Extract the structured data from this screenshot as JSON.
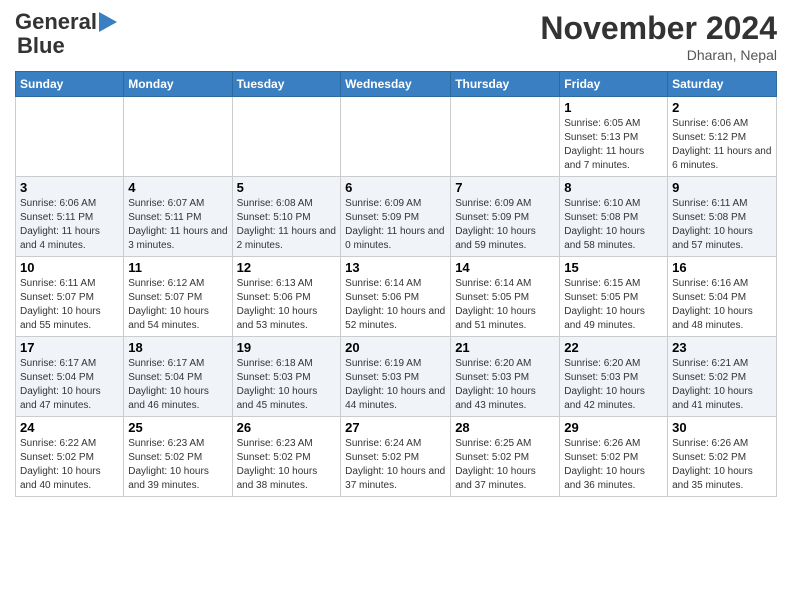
{
  "header": {
    "logo_general": "General",
    "logo_blue": "Blue",
    "month_title": "November 2024",
    "location": "Dharan, Nepal"
  },
  "weekdays": [
    "Sunday",
    "Monday",
    "Tuesday",
    "Wednesday",
    "Thursday",
    "Friday",
    "Saturday"
  ],
  "weeks": [
    [
      {
        "day": "",
        "info": ""
      },
      {
        "day": "",
        "info": ""
      },
      {
        "day": "",
        "info": ""
      },
      {
        "day": "",
        "info": ""
      },
      {
        "day": "",
        "info": ""
      },
      {
        "day": "1",
        "info": "Sunrise: 6:05 AM\nSunset: 5:13 PM\nDaylight: 11 hours and 7 minutes."
      },
      {
        "day": "2",
        "info": "Sunrise: 6:06 AM\nSunset: 5:12 PM\nDaylight: 11 hours and 6 minutes."
      }
    ],
    [
      {
        "day": "3",
        "info": "Sunrise: 6:06 AM\nSunset: 5:11 PM\nDaylight: 11 hours and 4 minutes."
      },
      {
        "day": "4",
        "info": "Sunrise: 6:07 AM\nSunset: 5:11 PM\nDaylight: 11 hours and 3 minutes."
      },
      {
        "day": "5",
        "info": "Sunrise: 6:08 AM\nSunset: 5:10 PM\nDaylight: 11 hours and 2 minutes."
      },
      {
        "day": "6",
        "info": "Sunrise: 6:09 AM\nSunset: 5:09 PM\nDaylight: 11 hours and 0 minutes."
      },
      {
        "day": "7",
        "info": "Sunrise: 6:09 AM\nSunset: 5:09 PM\nDaylight: 10 hours and 59 minutes."
      },
      {
        "day": "8",
        "info": "Sunrise: 6:10 AM\nSunset: 5:08 PM\nDaylight: 10 hours and 58 minutes."
      },
      {
        "day": "9",
        "info": "Sunrise: 6:11 AM\nSunset: 5:08 PM\nDaylight: 10 hours and 57 minutes."
      }
    ],
    [
      {
        "day": "10",
        "info": "Sunrise: 6:11 AM\nSunset: 5:07 PM\nDaylight: 10 hours and 55 minutes."
      },
      {
        "day": "11",
        "info": "Sunrise: 6:12 AM\nSunset: 5:07 PM\nDaylight: 10 hours and 54 minutes."
      },
      {
        "day": "12",
        "info": "Sunrise: 6:13 AM\nSunset: 5:06 PM\nDaylight: 10 hours and 53 minutes."
      },
      {
        "day": "13",
        "info": "Sunrise: 6:14 AM\nSunset: 5:06 PM\nDaylight: 10 hours and 52 minutes."
      },
      {
        "day": "14",
        "info": "Sunrise: 6:14 AM\nSunset: 5:05 PM\nDaylight: 10 hours and 51 minutes."
      },
      {
        "day": "15",
        "info": "Sunrise: 6:15 AM\nSunset: 5:05 PM\nDaylight: 10 hours and 49 minutes."
      },
      {
        "day": "16",
        "info": "Sunrise: 6:16 AM\nSunset: 5:04 PM\nDaylight: 10 hours and 48 minutes."
      }
    ],
    [
      {
        "day": "17",
        "info": "Sunrise: 6:17 AM\nSunset: 5:04 PM\nDaylight: 10 hours and 47 minutes."
      },
      {
        "day": "18",
        "info": "Sunrise: 6:17 AM\nSunset: 5:04 PM\nDaylight: 10 hours and 46 minutes."
      },
      {
        "day": "19",
        "info": "Sunrise: 6:18 AM\nSunset: 5:03 PM\nDaylight: 10 hours and 45 minutes."
      },
      {
        "day": "20",
        "info": "Sunrise: 6:19 AM\nSunset: 5:03 PM\nDaylight: 10 hours and 44 minutes."
      },
      {
        "day": "21",
        "info": "Sunrise: 6:20 AM\nSunset: 5:03 PM\nDaylight: 10 hours and 43 minutes."
      },
      {
        "day": "22",
        "info": "Sunrise: 6:20 AM\nSunset: 5:03 PM\nDaylight: 10 hours and 42 minutes."
      },
      {
        "day": "23",
        "info": "Sunrise: 6:21 AM\nSunset: 5:02 PM\nDaylight: 10 hours and 41 minutes."
      }
    ],
    [
      {
        "day": "24",
        "info": "Sunrise: 6:22 AM\nSunset: 5:02 PM\nDaylight: 10 hours and 40 minutes."
      },
      {
        "day": "25",
        "info": "Sunrise: 6:23 AM\nSunset: 5:02 PM\nDaylight: 10 hours and 39 minutes."
      },
      {
        "day": "26",
        "info": "Sunrise: 6:23 AM\nSunset: 5:02 PM\nDaylight: 10 hours and 38 minutes."
      },
      {
        "day": "27",
        "info": "Sunrise: 6:24 AM\nSunset: 5:02 PM\nDaylight: 10 hours and 37 minutes."
      },
      {
        "day": "28",
        "info": "Sunrise: 6:25 AM\nSunset: 5:02 PM\nDaylight: 10 hours and 37 minutes."
      },
      {
        "day": "29",
        "info": "Sunrise: 6:26 AM\nSunset: 5:02 PM\nDaylight: 10 hours and 36 minutes."
      },
      {
        "day": "30",
        "info": "Sunrise: 6:26 AM\nSunset: 5:02 PM\nDaylight: 10 hours and 35 minutes."
      }
    ]
  ]
}
